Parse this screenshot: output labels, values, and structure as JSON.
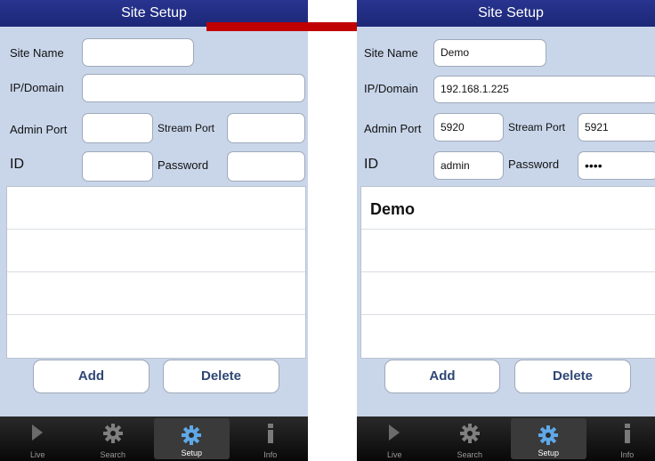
{
  "screens": [
    {
      "title": "Site Setup",
      "labels": {
        "site_name": "Site Name",
        "ip_domain": "IP/Domain",
        "admin_port": "Admin Port",
        "stream_port": "Stream Port",
        "id": "ID",
        "password": "Password"
      },
      "values": {
        "site_name": "",
        "ip_domain": "",
        "admin_port": "",
        "stream_port": "",
        "id": "",
        "password": ""
      },
      "sites": [],
      "buttons": {
        "add": "Add",
        "delete": "Delete"
      },
      "tabs": [
        {
          "label": "Live",
          "icon": "play-icon"
        },
        {
          "label": "Search",
          "icon": "gear-icon"
        },
        {
          "label": "Setup",
          "icon": "gear-icon"
        },
        {
          "label": "Info",
          "icon": "info-icon"
        }
      ],
      "active_tab": "Setup"
    },
    {
      "title": "Site Setup",
      "labels": {
        "site_name": "Site Name",
        "ip_domain": "IP/Domain",
        "admin_port": "Admin Port",
        "stream_port": "Stream Port",
        "id": "ID",
        "password": "Password"
      },
      "values": {
        "site_name": "Demo",
        "ip_domain": "192.168.1.225",
        "admin_port": "5920",
        "stream_port": "5921",
        "id": "admin",
        "password": "••••"
      },
      "sites": [
        "Demo"
      ],
      "buttons": {
        "add": "Add",
        "delete": "Delete"
      },
      "tabs": [
        {
          "label": "Live",
          "icon": "play-icon"
        },
        {
          "label": "Search",
          "icon": "gear-icon"
        },
        {
          "label": "Setup",
          "icon": "gear-icon"
        },
        {
          "label": "Info",
          "icon": "info-icon"
        }
      ],
      "active_tab": "Setup"
    }
  ],
  "colors": {
    "title_bar": "#1c2777",
    "screen_bg": "#c9d6ea",
    "arrow": "#c00000",
    "button_text": "#2f4775",
    "tab_bar": "#111111"
  }
}
